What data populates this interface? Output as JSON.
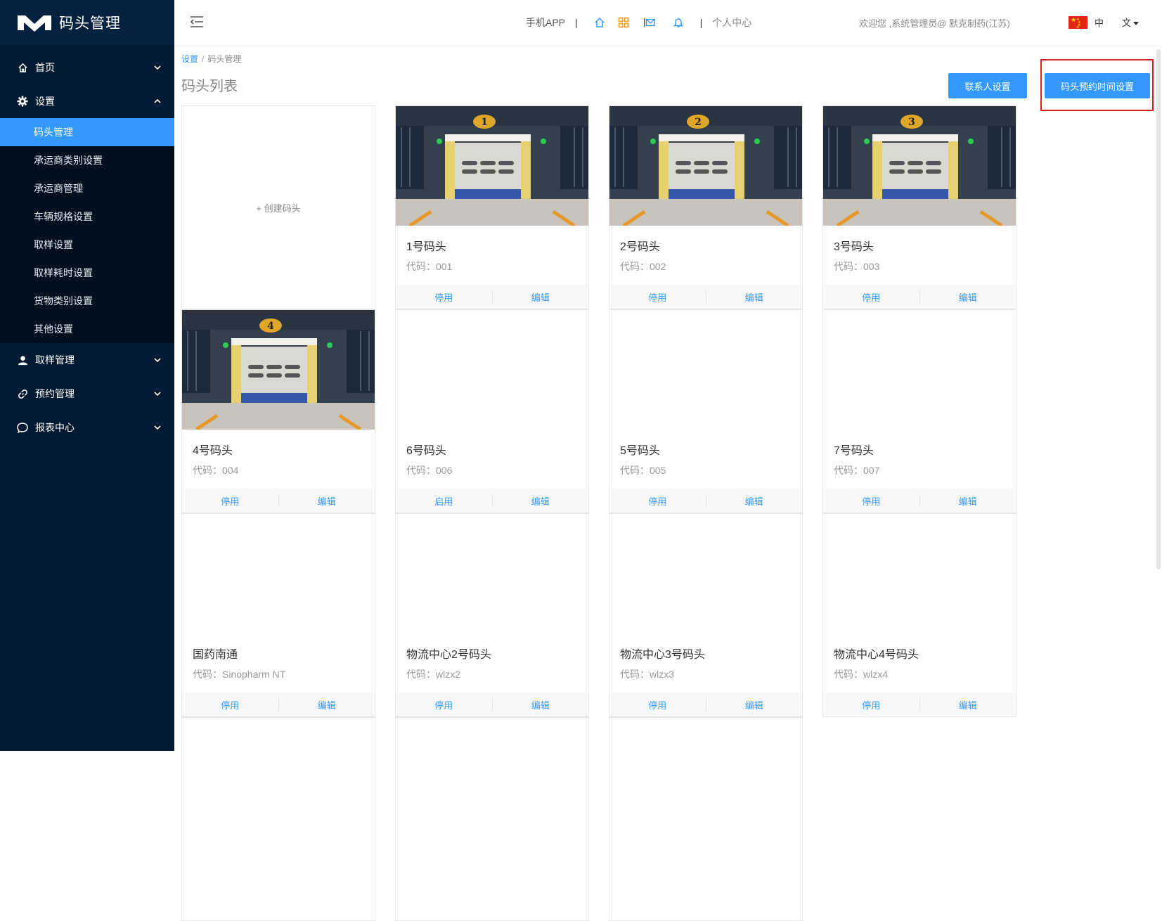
{
  "app": {
    "title": "码头管理"
  },
  "sidebar": {
    "groups": [
      {
        "label": "首页",
        "icon": "home-icon",
        "expanded": false
      },
      {
        "label": "设置",
        "icon": "gear-icon",
        "expanded": true,
        "items": [
          "码头管理",
          "承运商类别设置",
          "承运商管理",
          "车辆规格设置",
          "取样设置",
          "取样耗时设置",
          "货物类别设置",
          "其他设置"
        ],
        "active_item": "码头管理"
      },
      {
        "label": "取样管理",
        "icon": "user-icon",
        "expanded": false
      },
      {
        "label": "预约管理",
        "icon": "link-icon",
        "expanded": false
      },
      {
        "label": "报表中心",
        "icon": "chat-icon",
        "expanded": false
      }
    ]
  },
  "topbar": {
    "mobile_app": "手机APP",
    "sep": "|",
    "personal_center": "个人中心",
    "welcome": "欢迎您 ,系统管理员@ 默克制药(江苏)",
    "lang_label": "中",
    "lang_switch": "文"
  },
  "breadcrumb": {
    "root": "设置",
    "current": "码头管理"
  },
  "page": {
    "title": "码头列表"
  },
  "buttons": {
    "contact": "联系人设置",
    "time": "码头预约时间设置"
  },
  "create_card": {
    "label": "+ 创建码头"
  },
  "code_prefix": "代码：",
  "docks": [
    {
      "name": "1号码头",
      "code": "001",
      "status_action": "停用",
      "edit": "编辑",
      "has_image": true,
      "number": "1"
    },
    {
      "name": "2号码头",
      "code": "002",
      "status_action": "停用",
      "edit": "编辑",
      "has_image": true,
      "number": "2"
    },
    {
      "name": "3号码头",
      "code": "003",
      "status_action": "停用",
      "edit": "编辑",
      "has_image": true,
      "number": "3"
    },
    {
      "name": "4号码头",
      "code": "004",
      "status_action": "停用",
      "edit": "编辑",
      "has_image": true,
      "number": "4"
    },
    {
      "name": "6号码头",
      "code": "006",
      "status_action": "启用",
      "edit": "编辑",
      "has_image": false
    },
    {
      "name": "5号码头",
      "code": "005",
      "status_action": "停用",
      "edit": "编辑",
      "has_image": false
    },
    {
      "name": "7号码头",
      "code": "007",
      "status_action": "停用",
      "edit": "编辑",
      "has_image": false
    },
    {
      "name": "国药南通",
      "code": "Sinopharm NT",
      "status_action": "停用",
      "edit": "编辑",
      "has_image": false
    },
    {
      "name": "物流中心2号码头",
      "code": "wlzx2",
      "status_action": "停用",
      "edit": "编辑",
      "has_image": false
    },
    {
      "name": "物流中心3号码头",
      "code": "wlzx3",
      "status_action": "停用",
      "edit": "编辑",
      "has_image": false
    },
    {
      "name": "物流中心4号码头",
      "code": "wlzx4",
      "status_action": "停用",
      "edit": "编辑",
      "has_image": false
    }
  ],
  "colors": {
    "accent": "#3399ff",
    "sidebar_bg": "#031a33",
    "highlight": "#e02020"
  }
}
